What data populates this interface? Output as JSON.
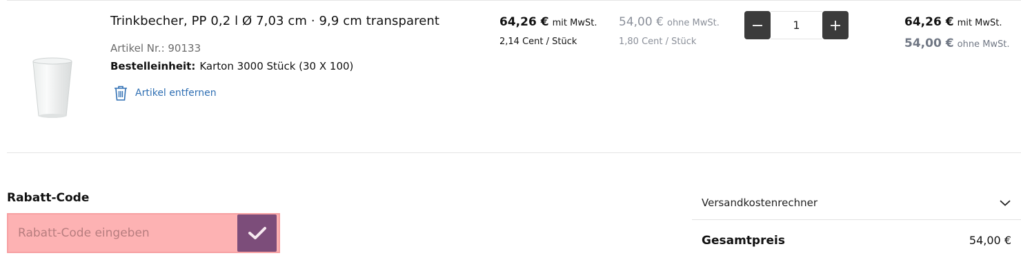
{
  "item": {
    "title": "Trinkbecher, PP 0,2 l Ø 7,03 cm · 9,9 cm transparent",
    "artikel_nr": "Artikel Nr.: 90133",
    "unit_label": "Bestelleinheit:",
    "unit_value": "Karton 3000 Stück (30 X 100)",
    "remove_label": "Artikel entfernen",
    "price_gross": "64,26 €",
    "price_gross_suffix": "mit MwSt.",
    "price_gross_per_piece": "2,14 Cent / Stück",
    "price_net": "54,00 €",
    "price_net_suffix": "ohne MwSt.",
    "price_net_per_piece": "1,80 Cent / Stück",
    "quantity": "1",
    "total_gross": "64,26 €",
    "total_gross_suffix": "mit MwSt.",
    "total_net": "54,00 €",
    "total_net_suffix": "ohne MwSt."
  },
  "discount": {
    "title": "Rabatt-Code",
    "placeholder": "Rabatt-Code eingeben",
    "value": ""
  },
  "summary": {
    "shipping_calculator_label": "Versandkostenrechner",
    "total_label": "Gesamtpreis",
    "total_value": "54,00 €"
  },
  "icons": {
    "remove": "trash-icon",
    "decrease": "minus-icon",
    "increase": "plus-icon",
    "apply": "check-icon",
    "expand": "chevron-down-icon"
  },
  "colors": {
    "link": "#2f6fb3",
    "qty_buttons": "#3b3b3b",
    "apply_button": "#7c4d7a",
    "discount_highlight": "#fdb2b3"
  }
}
